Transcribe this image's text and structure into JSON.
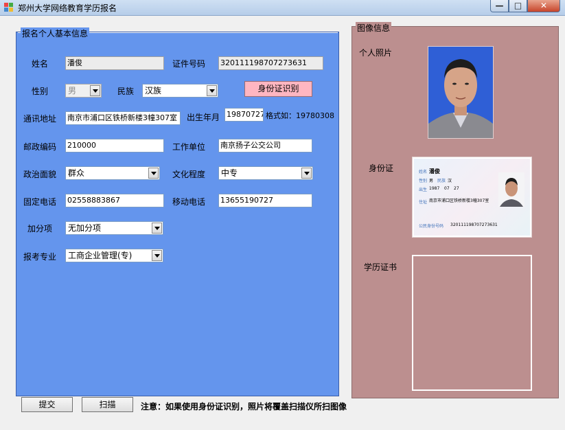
{
  "window": {
    "title": "郑州大学网络教育学历报名",
    "minimize": "—",
    "maximize": "□",
    "close": "✕"
  },
  "form": {
    "group_title": "报名个人基本信息",
    "name": {
      "label": "姓名",
      "value": "潘俊"
    },
    "id_number": {
      "label": "证件号码",
      "value": "320111198707273631"
    },
    "gender": {
      "label": "性别",
      "value": "男"
    },
    "ethnicity": {
      "label": "民族",
      "value": "汉族"
    },
    "id_recognize_button": "身份证识别",
    "address": {
      "label": "通讯地址",
      "value": "南京市浦口区铁桥新楼3幢307室"
    },
    "birth": {
      "label": "出生年月",
      "value": "19870727",
      "hint": "格式如：19780308"
    },
    "postcode": {
      "label": "邮政编码",
      "value": "210000"
    },
    "employer": {
      "label": "工作单位",
      "value": "南京扬子公交公司"
    },
    "political": {
      "label": "政治面貌",
      "value": "群众"
    },
    "education": {
      "label": "文化程度",
      "value": "中专"
    },
    "phone": {
      "label": "固定电话",
      "value": "02558883867"
    },
    "mobile": {
      "label": "移动电话",
      "value": "13655190727"
    },
    "bonus": {
      "label": "加分项",
      "value": "无加分项"
    },
    "major": {
      "label": "报考专业",
      "value": "工商企业管理(专)"
    }
  },
  "images": {
    "group_title": "图像信息",
    "photo_label": "个人照片",
    "idcard_label": "身份证",
    "diploma_label": "学历证书",
    "idcard": {
      "name_key": "姓名",
      "name": "潘俊",
      "gender_key": "性别",
      "gender": "男",
      "nation_key": "民族",
      "nation": "汉",
      "birth_key": "出生",
      "year": "1987",
      "month": "07",
      "day": "27",
      "address_key": "住址",
      "address": "南京市浦口区铁桥新楼3幢307室",
      "number_key": "公民身份号码",
      "number": "320111198707273631"
    }
  },
  "footer": {
    "submit": "提交",
    "scan": "扫描",
    "note": "注意：如果使用身份证识别，照片将覆盖扫描仪所扫图像"
  }
}
